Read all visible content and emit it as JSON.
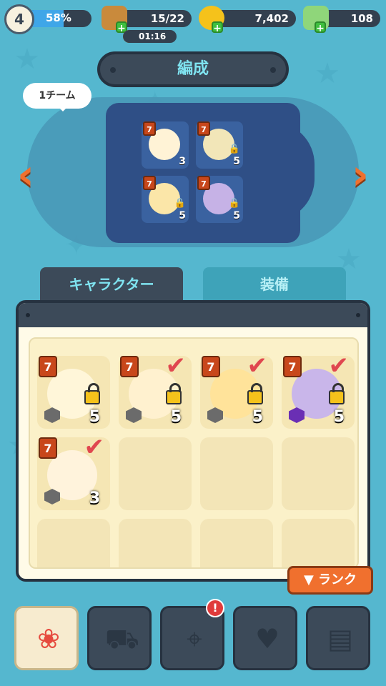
{
  "header": {
    "level": "4",
    "xp_percent_text": "58%",
    "xp_fraction": 0.58,
    "stamina": "15/22",
    "stamina_timer": "01:16",
    "coins": "7,402",
    "potions": "108",
    "plus_label": "+"
  },
  "formation": {
    "title": "編成",
    "team_label": "1チーム",
    "prev_arrow": "‹",
    "next_arrow": "›",
    "slots": [
      {
        "rank": "7",
        "count": "3",
        "locked": false,
        "color": "#fff3d6"
      },
      {
        "rank": "7",
        "count": "5",
        "locked": true,
        "color": "#f2e6b8"
      },
      {
        "rank": "7",
        "count": "5",
        "locked": true,
        "color": "#fbe6a8"
      },
      {
        "rank": "7",
        "count": "5",
        "locked": true,
        "color": "#c6b2e6"
      }
    ]
  },
  "tabs": {
    "character": "キャラクター",
    "equipment": "装備"
  },
  "inventory": {
    "items": [
      {
        "rank": "7",
        "count": "5",
        "locked": true,
        "checked": false,
        "hex": "gray",
        "color": "#fff6d9"
      },
      {
        "rank": "7",
        "count": "5",
        "locked": true,
        "checked": true,
        "hex": "gray",
        "color": "#fff1cf"
      },
      {
        "rank": "7",
        "count": "5",
        "locked": true,
        "checked": true,
        "hex": "gray",
        "color": "#ffe39a"
      },
      {
        "rank": "7",
        "count": "5",
        "locked": true,
        "checked": true,
        "hex": "moon",
        "color": "#c9b6ea"
      },
      {
        "rank": "7",
        "count": "3",
        "locked": false,
        "checked": true,
        "hex": "gray",
        "color": "#fff3dc"
      }
    ],
    "check_glyph": "✔",
    "sort_button": "▼ ランク"
  },
  "nav": {
    "icons": [
      "sheep-icon",
      "truck-icon",
      "map-icon",
      "shop-bag-icon",
      "scroll-icon"
    ],
    "notification": "!"
  }
}
